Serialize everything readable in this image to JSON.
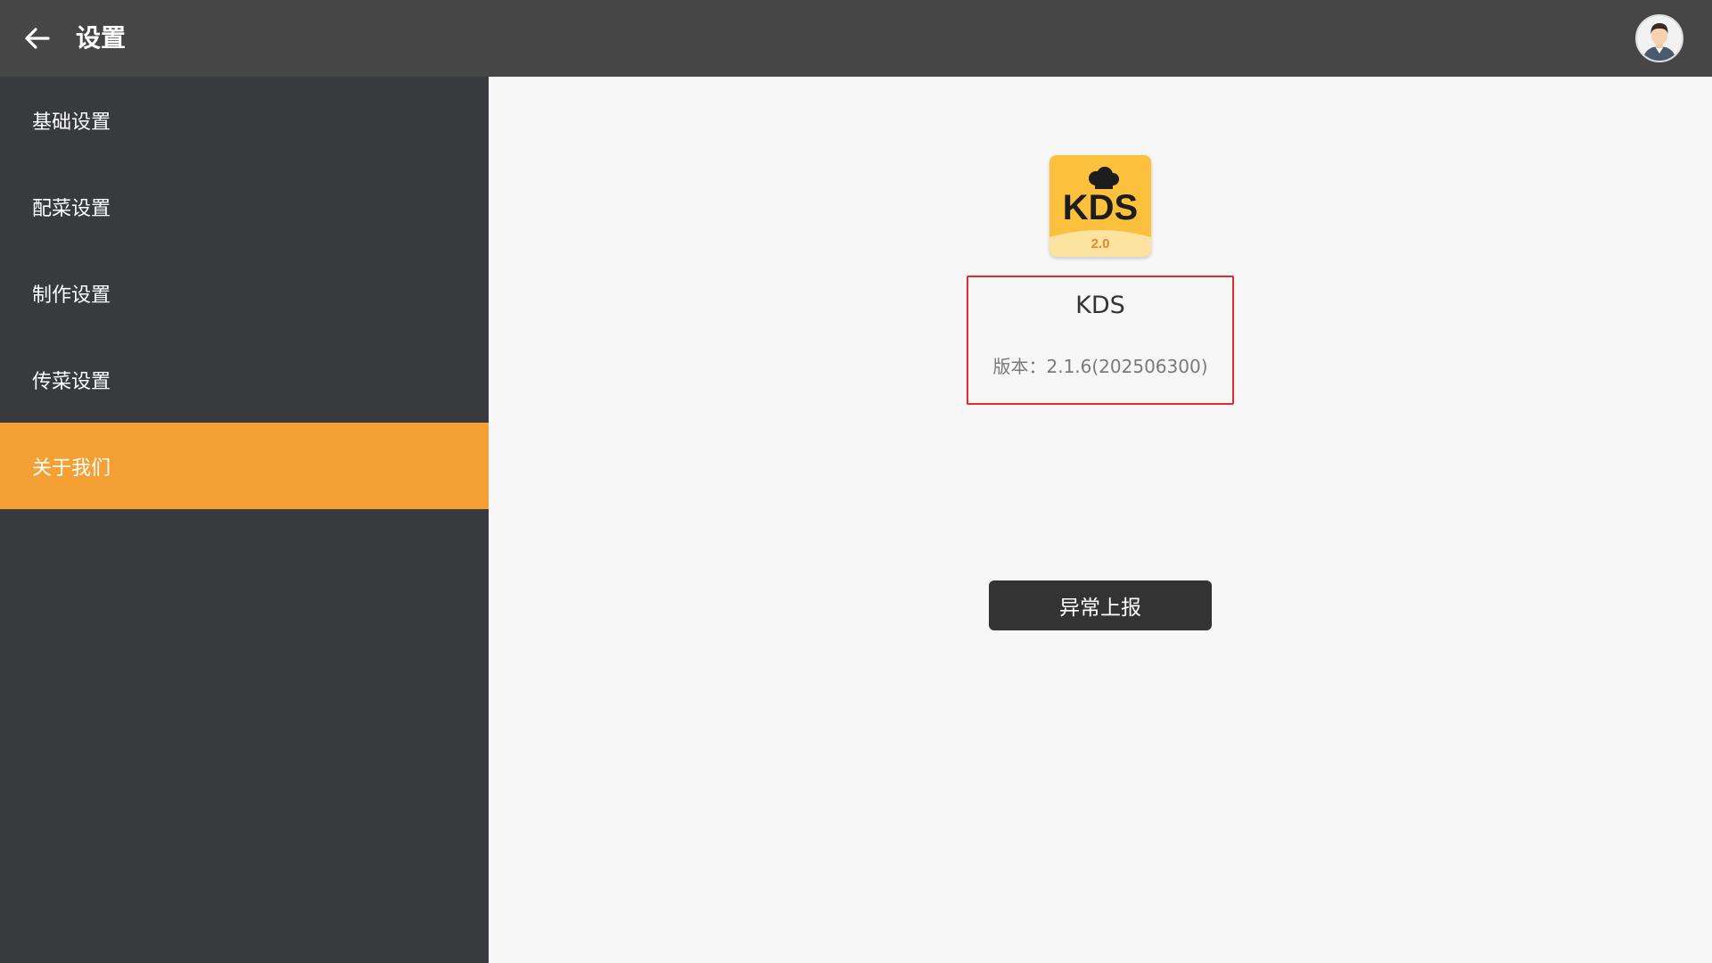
{
  "header": {
    "title": "设置",
    "back_icon": "arrow-left-icon",
    "avatar_icon": "user-avatar-icon"
  },
  "sidebar": {
    "items": [
      {
        "label": "基础设置",
        "active": false
      },
      {
        "label": "配菜设置",
        "active": false
      },
      {
        "label": "制作设置",
        "active": false
      },
      {
        "label": "传菜设置",
        "active": false
      },
      {
        "label": "关于我们",
        "active": true
      }
    ]
  },
  "about": {
    "logo_text": "KDS",
    "logo_version": "2.0",
    "app_name": "KDS",
    "version_text": "版本：2.1.6(202506300)",
    "report_button": "异常上报"
  },
  "colors": {
    "accent": "#f4a035",
    "topbar": "#464646",
    "sidebar": "#393a3e",
    "highlight_border": "#e8282d",
    "logo_bg": "#fbc13c"
  }
}
